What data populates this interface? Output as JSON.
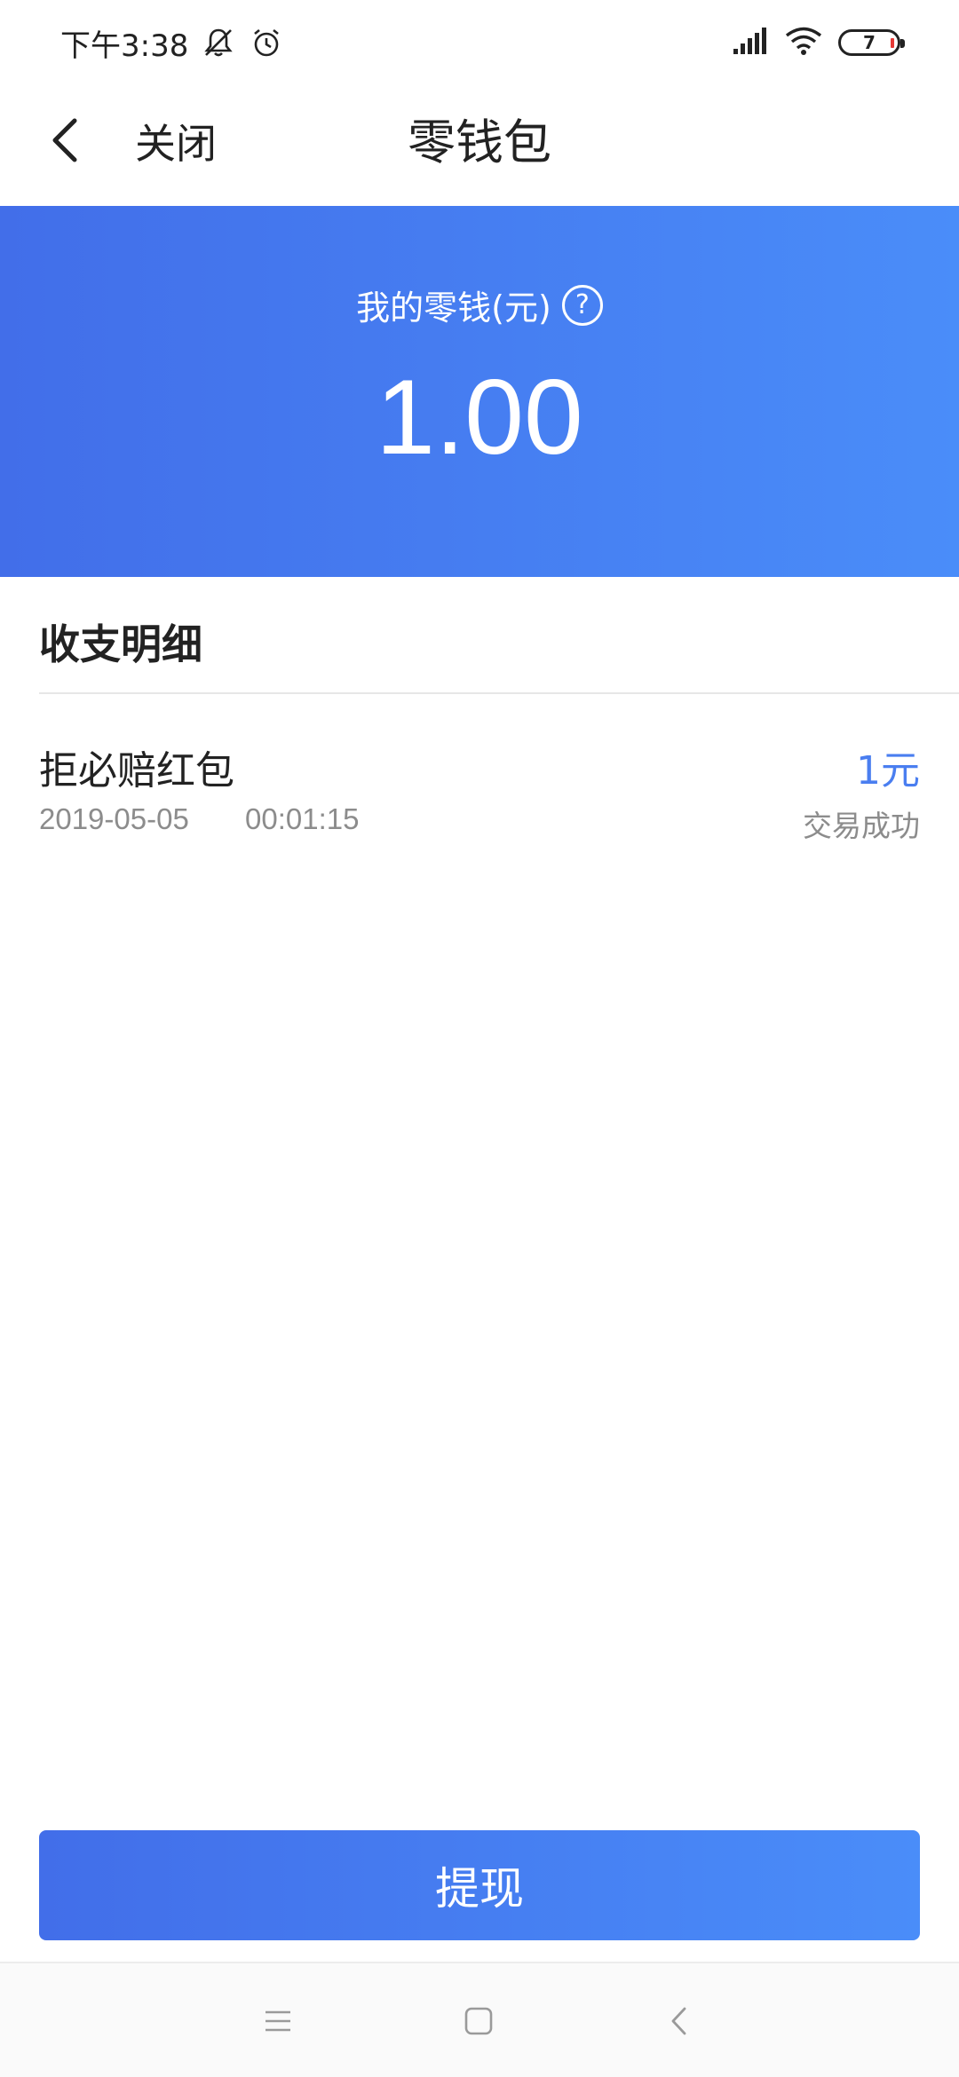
{
  "status_bar": {
    "time": "下午3:38",
    "icons": [
      "notifications-muted-icon",
      "alarm-icon",
      "signal-icon",
      "wifi-icon",
      "battery-icon"
    ],
    "battery_level": "7",
    "battery_low_color": "#e53935"
  },
  "nav": {
    "back_icon": "chevron-left-icon",
    "close_label": "关闭",
    "title": "零钱包"
  },
  "balance_card": {
    "label": "我的零钱(元)",
    "help_icon": "question-circle-icon",
    "help_glyph": "?",
    "amount": "1.00",
    "gradient_start": "#426ee9",
    "gradient_end": "#4a8df9"
  },
  "details": {
    "section_title": "收支明细",
    "transactions": [
      {
        "title": "拒必赔红包",
        "date": "2019-05-05",
        "time": "00:01:15",
        "amount": "1元",
        "status": "交易成功",
        "amount_color": "#4a7ef0"
      }
    ]
  },
  "actions": {
    "withdraw_label": "提现"
  },
  "system_nav": {
    "buttons": [
      "menu-icon",
      "home-icon",
      "back-icon"
    ]
  }
}
